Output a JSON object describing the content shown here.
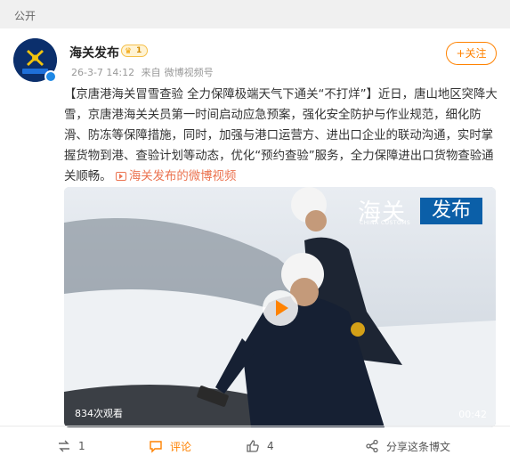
{
  "topbar": {
    "visibility": "公开"
  },
  "post": {
    "author": "海关发布",
    "vip_level": "1",
    "time": "26-3-7 14:12",
    "source_prefix": "来自",
    "source": "微博视频号",
    "follow_label": "+关注",
    "text": "【京唐港海关冒雪查验 全力保障极端天气下通关“不打烊”】近日，唐山地区突降大雪，京唐港海关关员第一时间启动应急预案，强化安全防护与作业规范，细化防滑、防冻等保障措施，同时，加强与港口运营方、进出口企业的联动沟通，实时掌握货物到港、查验计划等动态，优化“预约查验”服务，全力保障进出口货物查验通关顺畅。",
    "video_link": "海关发布的微博视频"
  },
  "video": {
    "brand_main": "海关",
    "brand_sub": "CHINA CUSTOMS",
    "brand_tag": "发布",
    "views": "834次观看",
    "duration": "00:42"
  },
  "actions": {
    "repost": "1",
    "comment": "评论",
    "like": "4",
    "share": "分享这条博文"
  },
  "colors": {
    "accent": "#ff8200",
    "link": "#eb7350",
    "brand_blue": "#0b5fa8"
  }
}
